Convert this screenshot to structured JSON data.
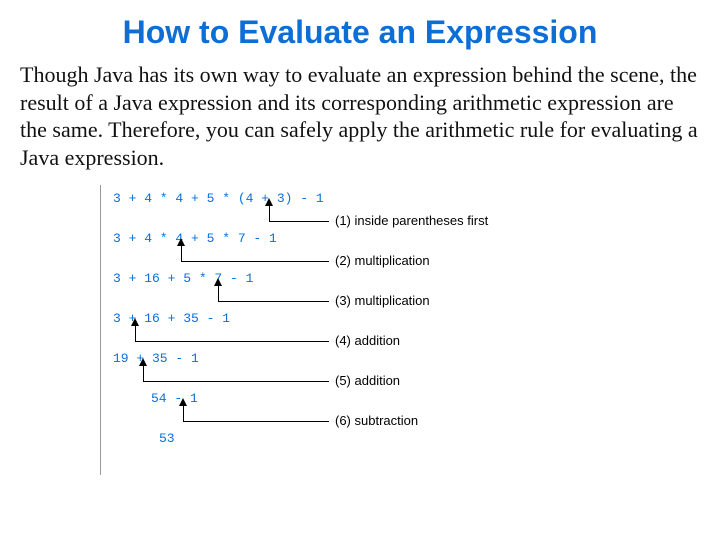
{
  "title": "How to Evaluate an Expression",
  "paragraph": "Though Java has its own way to evaluate an expression behind the scene, the result of a Java expression and its corresponding arithmetic expression are the same. Therefore, you can safely apply the arithmetic rule for evaluating a Java expression.",
  "steps": {
    "expr1": "3 + 4 * 4 + 5 * (4 + 3) - 1",
    "expr2": "3 + 4 * 4 + 5 * 7 - 1",
    "expr3": "3 + 16 + 5 * 7 - 1",
    "expr4": "3 + 16 + 35 - 1",
    "expr5": "19 + 35 - 1",
    "expr6": "54 - 1",
    "expr7": "53",
    "note1": "(1) inside parentheses first",
    "note2": "(2) multiplication",
    "note3": "(3) multiplication",
    "note4": "(4) addition",
    "note5": "(5) addition",
    "note6": "(6) subtraction"
  }
}
